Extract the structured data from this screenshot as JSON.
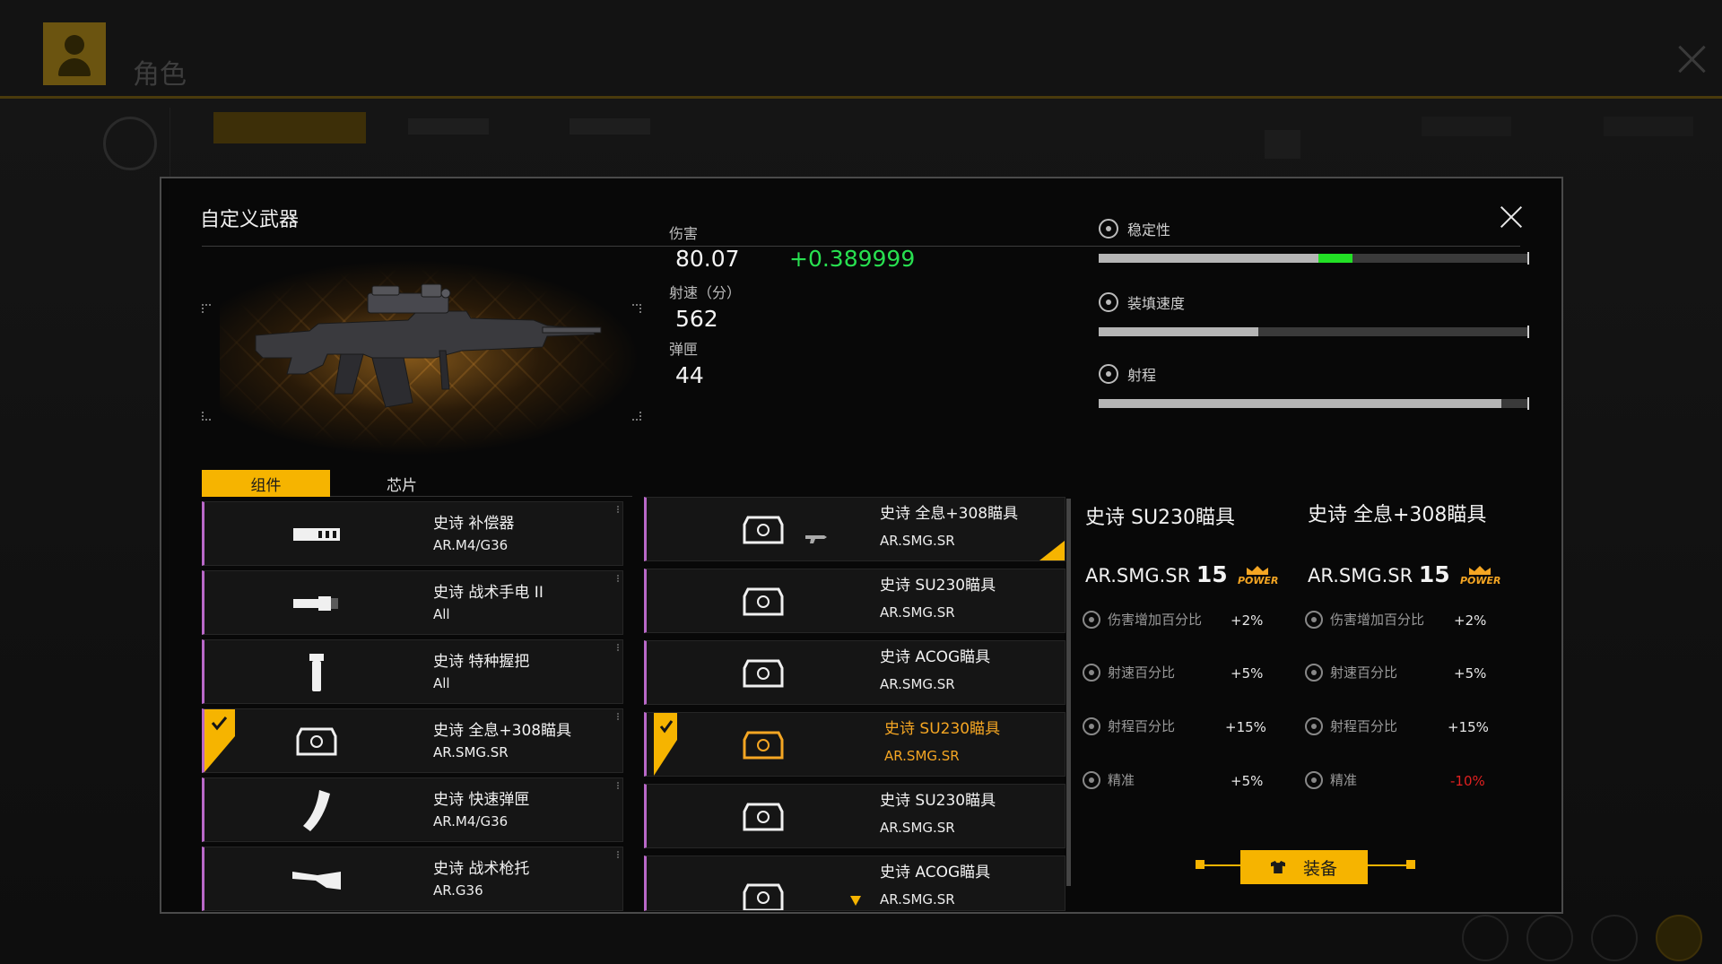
{
  "background": {
    "title": "角色"
  },
  "modal": {
    "title": "自定义武器"
  },
  "stats": {
    "damage_label": "伤害",
    "damage_value": "80.07",
    "damage_bonus": "+0.389999",
    "rate_label": "射速（分）",
    "rate_value": "562",
    "mag_label": "弹匣",
    "mag_value": "44"
  },
  "bars": [
    {
      "label": "稳定性",
      "icon": "stability-icon",
      "fill": 0.51,
      "green_fill": 0.08
    },
    {
      "label": "装填速度",
      "icon": "reload-icon",
      "fill": 0.37,
      "green_fill": 0
    },
    {
      "label": "射程",
      "icon": "range-icon",
      "fill": 0.935,
      "green_fill": 0
    }
  ],
  "tabs": {
    "components": "组件",
    "chips": "芯片"
  },
  "components": [
    {
      "name": "史诗 补偿器",
      "tag": "AR.M4/G36",
      "icon": "compensator-icon",
      "selected": false
    },
    {
      "name": "史诗 战术手电 II",
      "tag": "All",
      "icon": "flashlight-icon",
      "selected": false
    },
    {
      "name": "史诗 特种握把",
      "tag": "All",
      "icon": "grip-icon",
      "selected": false
    },
    {
      "name": "史诗 全息+308瞄具",
      "tag": "AR.SMG.SR",
      "icon": "holo-sight-icon",
      "selected": true
    },
    {
      "name": "史诗 快速弹匣",
      "tag": "AR.M4/G36",
      "icon": "magazine-icon",
      "selected": false
    },
    {
      "name": "史诗 战术枪托",
      "tag": "AR.G36",
      "icon": "stock-icon",
      "selected": false
    }
  ],
  "sights": [
    {
      "name": "史诗 全息+308瞄具",
      "tag": "AR.SMG.SR",
      "icon": "holo-sight-icon",
      "state": "equipped"
    },
    {
      "name": "史诗 SU230瞄具",
      "tag": "AR.SMG.SR",
      "icon": "holo-sight-icon",
      "state": "normal"
    },
    {
      "name": "史诗 ACOG瞄具",
      "tag": "AR.SMG.SR",
      "icon": "holo-sight-icon",
      "state": "normal"
    },
    {
      "name": "史诗 SU230瞄具",
      "tag": "AR.SMG.SR",
      "icon": "holo-sight-icon",
      "state": "selected"
    },
    {
      "name": "史诗 SU230瞄具",
      "tag": "AR.SMG.SR",
      "icon": "holo-sight-icon",
      "state": "normal"
    },
    {
      "name": "史诗 ACOG瞄具",
      "tag": "AR.SMG.SR",
      "icon": "holo-sight-icon",
      "state": "more"
    }
  ],
  "compare": {
    "left": {
      "title": "史诗 SU230瞄具",
      "type": "AR.SMG.SR",
      "level": "15",
      "badge": "POWER",
      "attrs": [
        {
          "label": "伤害增加百分比",
          "value": "+2%"
        },
        {
          "label": "射速百分比",
          "value": "+5%"
        },
        {
          "label": "射程百分比",
          "value": "+15%"
        },
        {
          "label": "精准",
          "value": "+5%"
        }
      ]
    },
    "right": {
      "title": "史诗 全息+308瞄具",
      "type": "AR.SMG.SR",
      "level": "15",
      "badge": "POWER",
      "attrs": [
        {
          "label": "伤害增加百分比",
          "value": "+2%"
        },
        {
          "label": "射速百分比",
          "value": "+5%"
        },
        {
          "label": "射程百分比",
          "value": "+15%"
        },
        {
          "label": "精准",
          "value": "-10%"
        }
      ]
    }
  },
  "equip": {
    "label": "装备"
  },
  "colors": {
    "accent": "#f6b400",
    "positive": "#22e025",
    "negative": "#e02020",
    "epic": "#b968c8"
  }
}
